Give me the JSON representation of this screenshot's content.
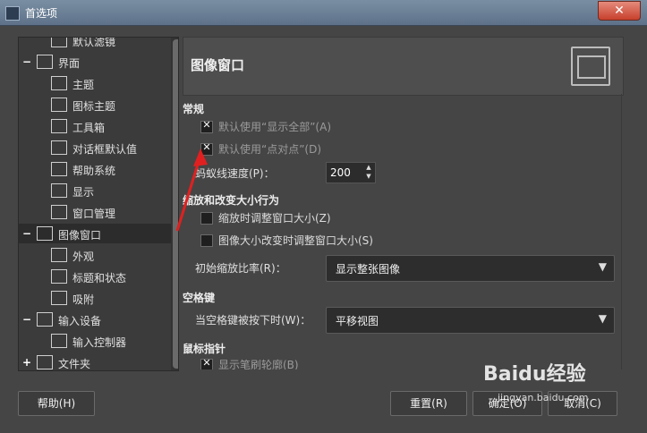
{
  "window": {
    "title": "首选项",
    "close_glyph": "✕"
  },
  "tree": {
    "items": [
      {
        "label": "默认滤镜",
        "indent": 2
      },
      {
        "label": "界面",
        "indent": 1,
        "expander": "−"
      },
      {
        "label": "主题",
        "indent": 2
      },
      {
        "label": "图标主题",
        "indent": 2
      },
      {
        "label": "工具箱",
        "indent": 2
      },
      {
        "label": "对话框默认值",
        "indent": 2
      },
      {
        "label": "帮助系统",
        "indent": 2
      },
      {
        "label": "显示",
        "indent": 2
      },
      {
        "label": "窗口管理",
        "indent": 2
      },
      {
        "label": "图像窗口",
        "indent": 1,
        "expander": "−",
        "selected": true
      },
      {
        "label": "外观",
        "indent": 2
      },
      {
        "label": "标题和状态",
        "indent": 2
      },
      {
        "label": "吸附",
        "indent": 2
      },
      {
        "label": "输入设备",
        "indent": 1,
        "expander": "−"
      },
      {
        "label": "输入控制器",
        "indent": 2
      },
      {
        "label": "文件夹",
        "indent": 1,
        "expander": "+"
      }
    ]
  },
  "header": {
    "title": "图像窗口",
    "icon": "image-window-icon"
  },
  "sections": {
    "general": {
      "title": "常规",
      "show_all": "默认使用“显示全部”(A)",
      "dot_for_dot": "默认使用“点对点”(D)",
      "marching_ants_label": "蚂蚁线速度(P)：",
      "marching_ants_value": "200"
    },
    "zoom": {
      "title": "缩放和改变大小行为",
      "resize_on_zoom": "缩放时调整窗口大小(Z)",
      "resize_on_image_change": "图像大小改变时调整窗口大小(S)",
      "initial_zoom_label": "初始缩放比率(R)：",
      "initial_zoom_value": "显示整张图像"
    },
    "space": {
      "title": "空格键",
      "space_label": "当空格键被按下时(W)：",
      "space_value": "平移视图"
    },
    "pointer": {
      "title": "鼠标指针",
      "brush_outline": "显示笔刷轮廓(B)"
    }
  },
  "buttons": {
    "help": "帮助(H)",
    "reset": "重置(R)",
    "ok": "确定(O)",
    "cancel": "取消(C)"
  },
  "watermark": {
    "brand": "Baidu经验",
    "url": "jingyan.baidu.com"
  },
  "colors": {
    "annotation_arrow": "#e02020",
    "selected_row": "#2c2c2c"
  }
}
